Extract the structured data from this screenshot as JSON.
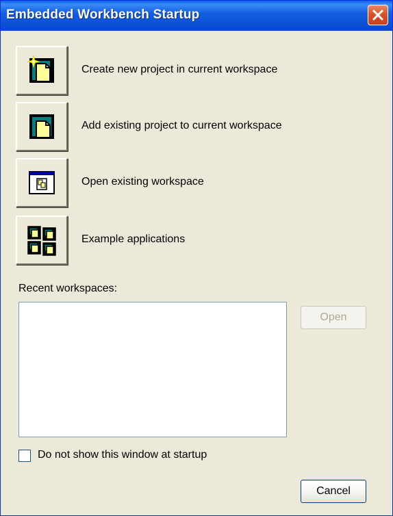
{
  "window": {
    "title": "Embedded Workbench Startup",
    "close_icon": "close-icon"
  },
  "actions": [
    {
      "label": "Create new project in current workspace",
      "icon": "new-project-icon"
    },
    {
      "label": "Add existing project to current workspace",
      "icon": "add-project-icon"
    },
    {
      "label": "Open existing workspace",
      "icon": "open-workspace-icon"
    },
    {
      "label": "Example applications",
      "icon": "example-applications-icon"
    }
  ],
  "recent": {
    "label": "Recent workspaces:",
    "items": []
  },
  "buttons": {
    "open_label": "Open",
    "cancel_label": "Cancel"
  },
  "startup_checkbox": {
    "label": "Do not show this window at startup",
    "checked": false
  },
  "colors": {
    "titlebar": "#0a5fe8",
    "dialog_bg": "#ece9d8",
    "close_button": "#d8532a",
    "disabled_text": "#aca899"
  }
}
